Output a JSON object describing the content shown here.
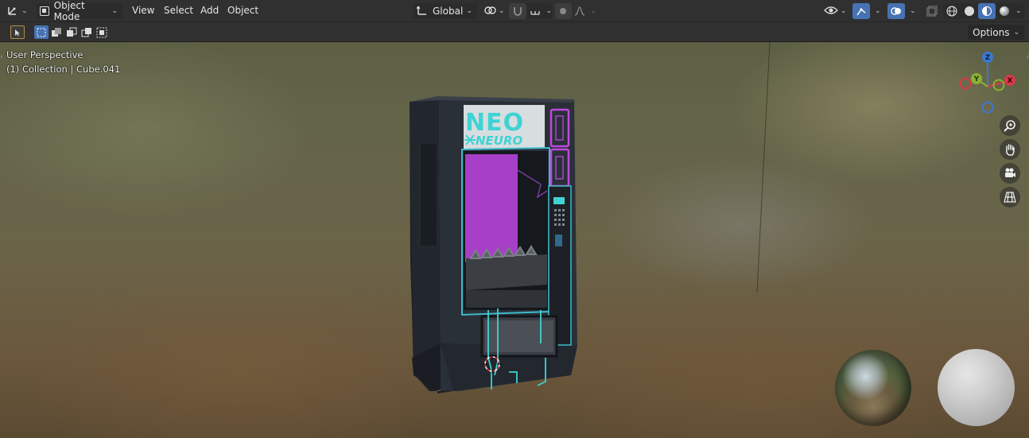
{
  "header": {
    "editor_type_icon": "axes-editor-icon",
    "mode_label": "Object Mode",
    "menus": [
      "View",
      "Select",
      "Add",
      "Object"
    ],
    "orientation_label": "Global"
  },
  "toolbar": {
    "options_label": "Options"
  },
  "viewport": {
    "perspective_label": "User Perspective",
    "collection_label": "(1) Collection | Cube.041",
    "gizmo": {
      "z": "Z",
      "y": "Y",
      "x": "X"
    }
  },
  "machine": {
    "logo_line1": "NEO",
    "logo_line2": "NEURO"
  },
  "colors": {
    "accent_blue": "#4772b3",
    "axis_x": "#d93a49",
    "axis_y": "#8bb132",
    "axis_z": "#3b78d4",
    "neon_cyan": "#3fd3d3",
    "neon_magenta": "#c048e0"
  }
}
